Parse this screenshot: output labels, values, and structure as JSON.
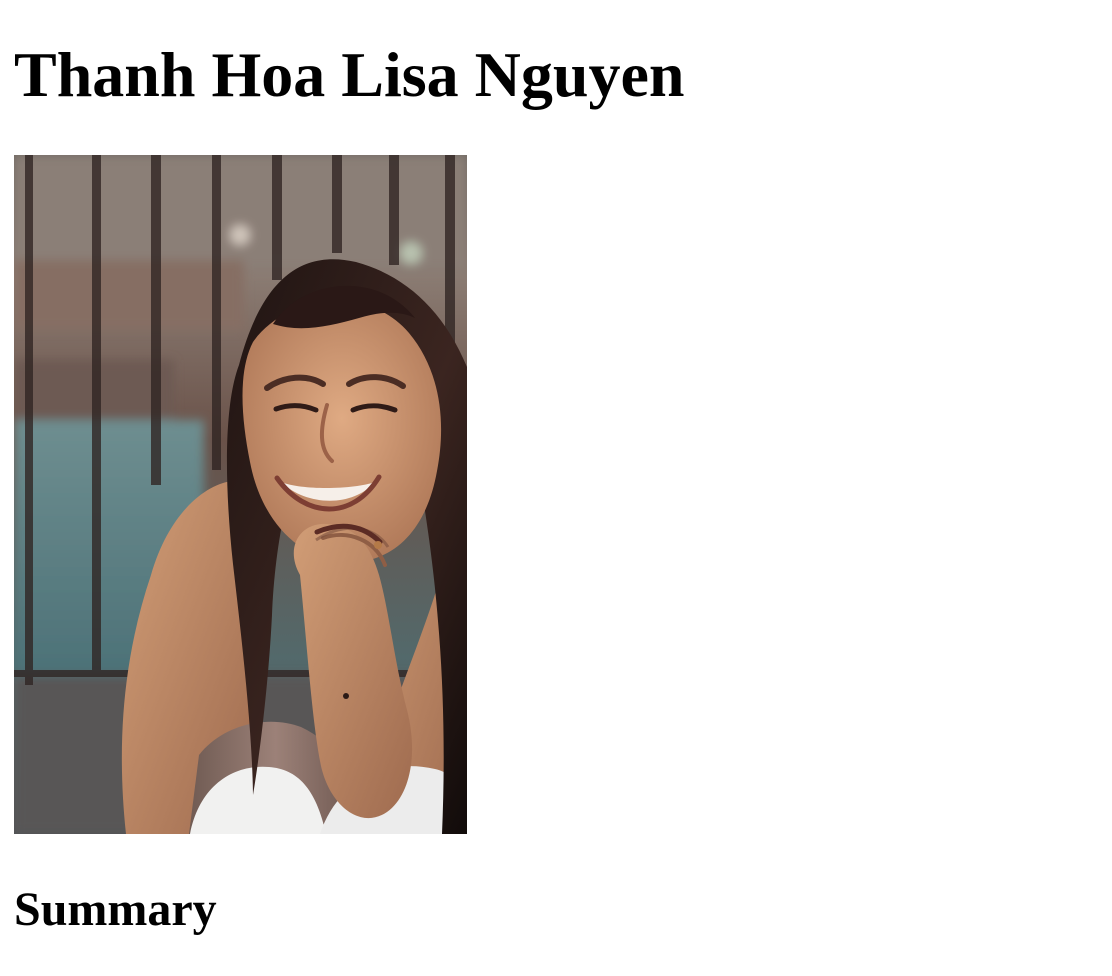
{
  "profile": {
    "name": "Thanh Hoa Lisa Nguyen",
    "photo_icon": "portrait-photo"
  },
  "sections": {
    "summary_heading": "Summary"
  }
}
